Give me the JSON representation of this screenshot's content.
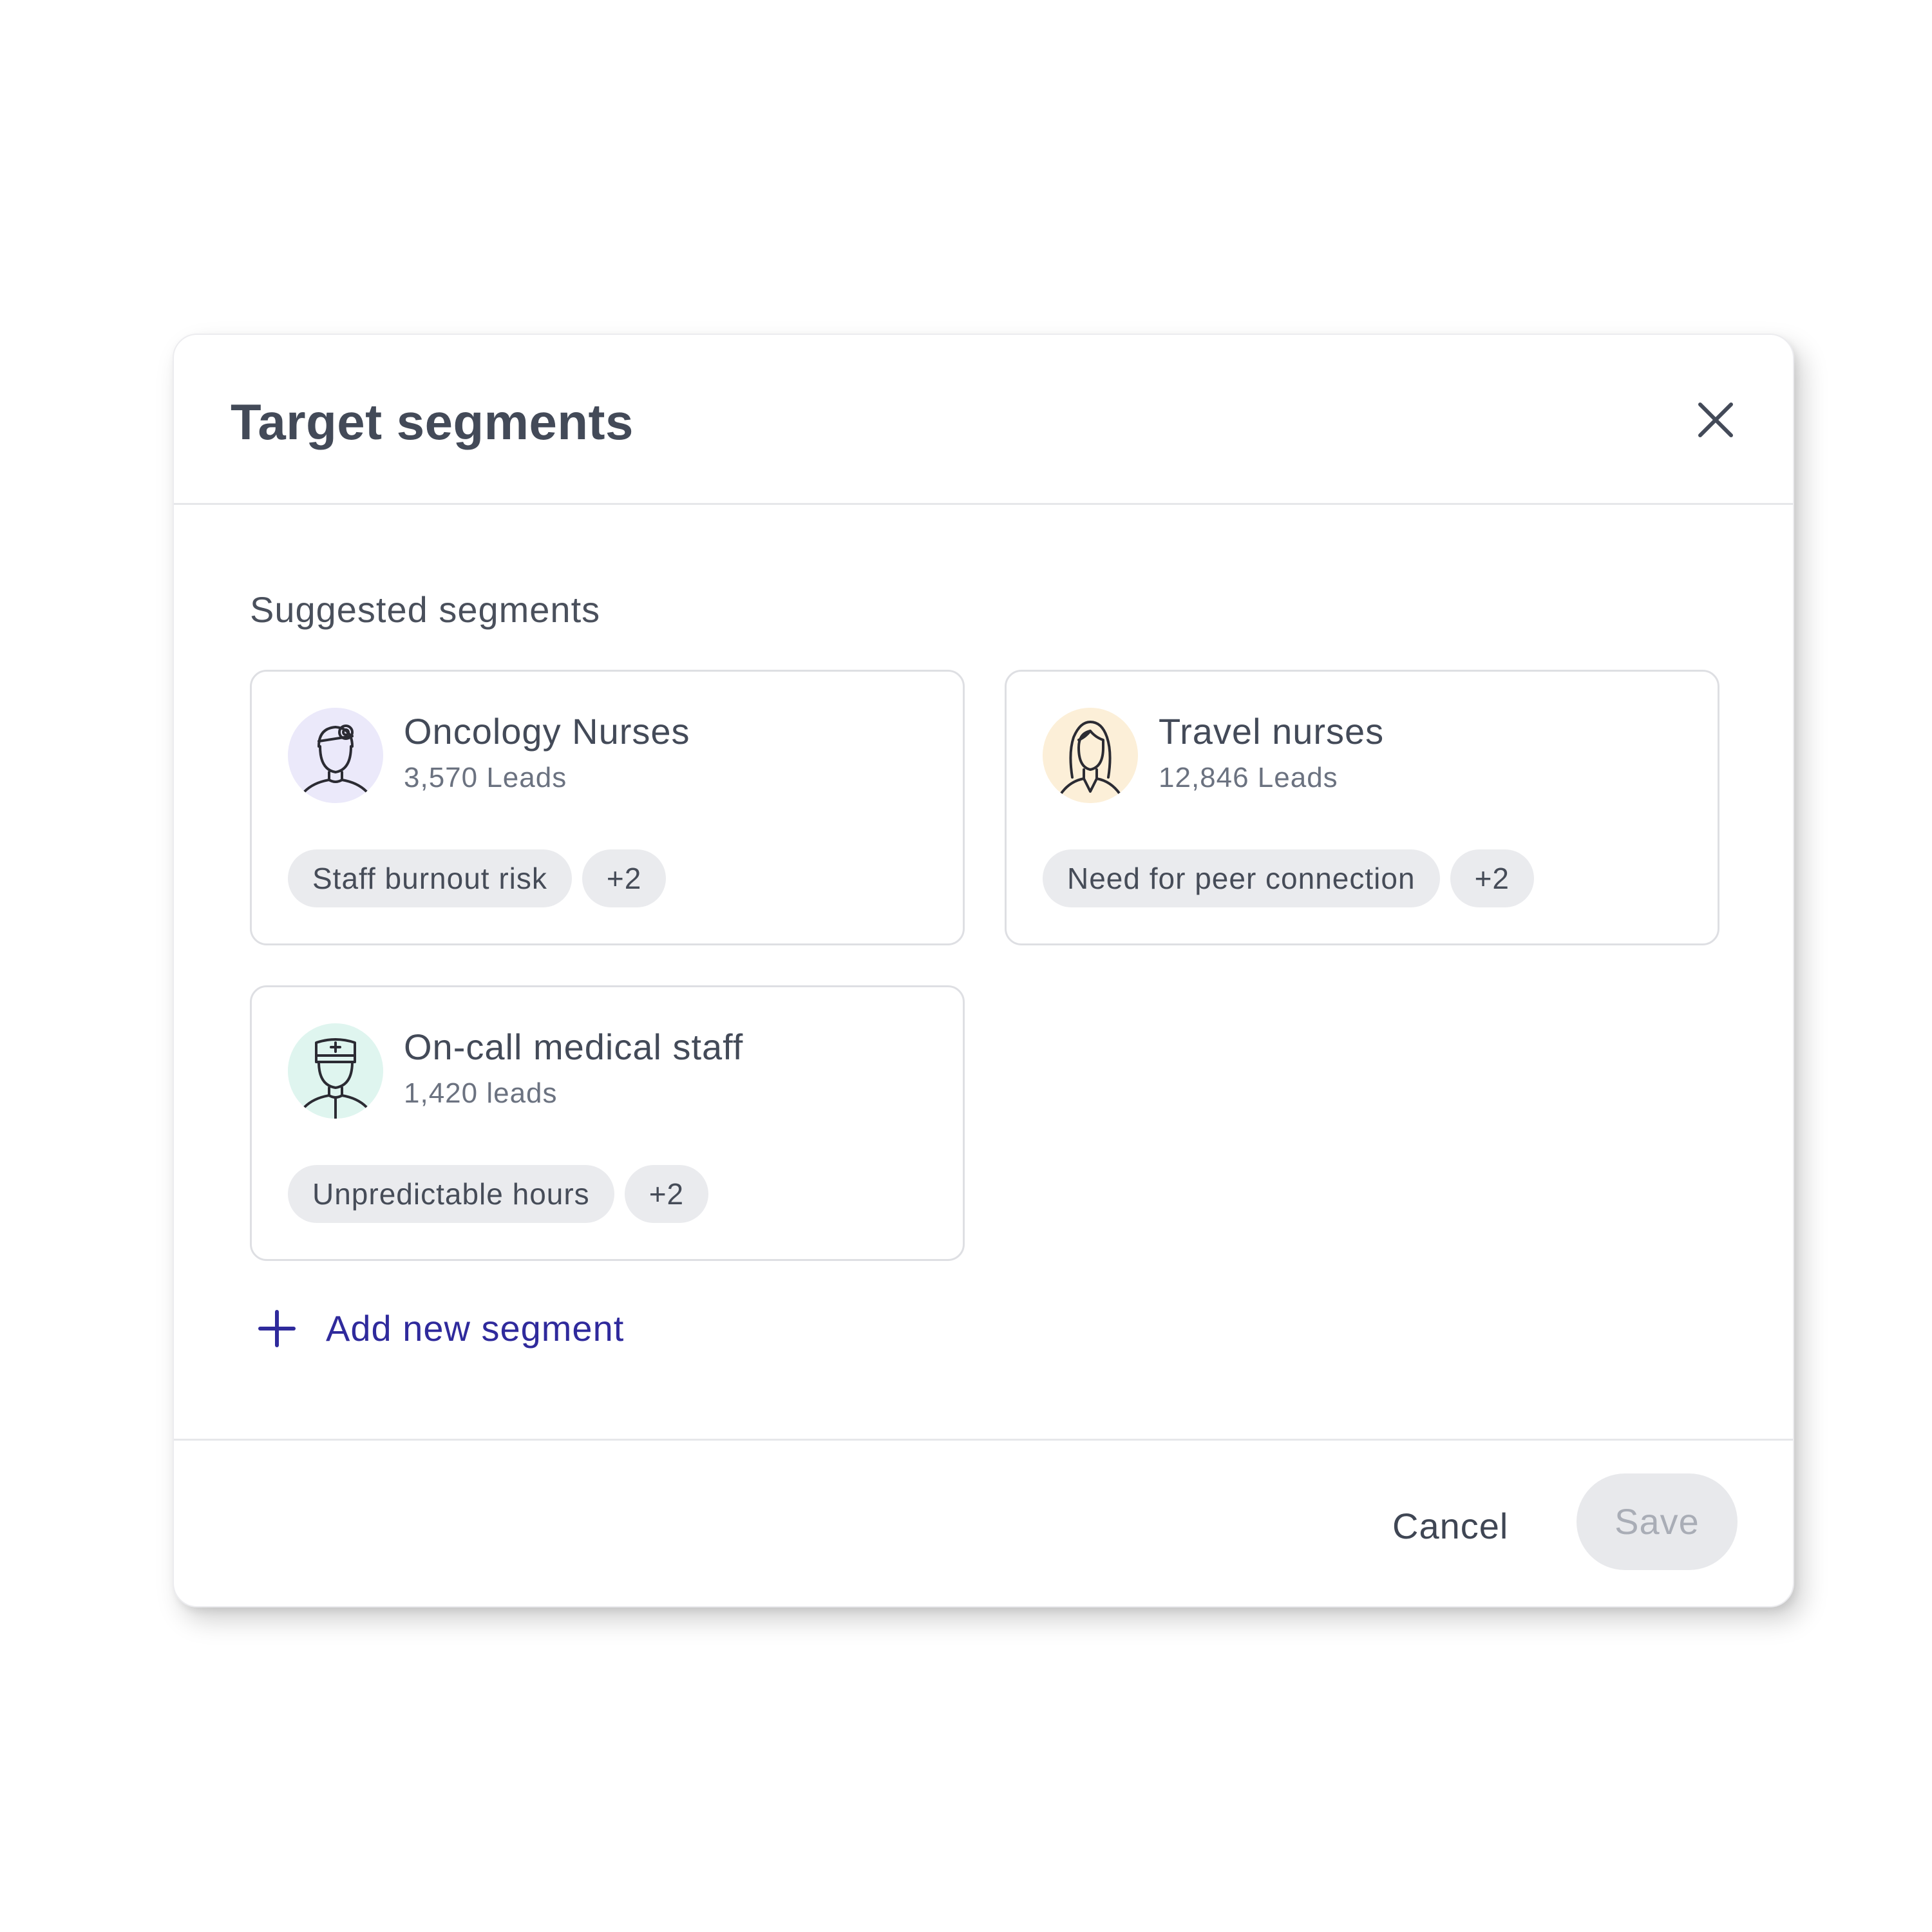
{
  "modal": {
    "title": "Target segments",
    "close_icon": "close-icon"
  },
  "section": {
    "label": "Suggested segments"
  },
  "segments": [
    {
      "name": "Oncology Nurses",
      "leads": "3,570 Leads",
      "avatar_icon": "doctor-head-mirror-icon",
      "avatar_bg": "#ebe9fa",
      "tags": [
        "Staff burnout risk"
      ],
      "more": "+2"
    },
    {
      "name": "Travel nurses",
      "leads": "12,846 Leads",
      "avatar_icon": "woman-icon",
      "avatar_bg": "#fcefd8",
      "tags": [
        "Need for peer connection"
      ],
      "more": "+2"
    },
    {
      "name": "On-call medical staff",
      "leads": "1,420 leads",
      "avatar_icon": "nurse-cap-icon",
      "avatar_bg": "#dff5ef",
      "tags": [
        "Unpredictable hours"
      ],
      "more": "+2"
    }
  ],
  "add_segment": {
    "label": "Add new segment",
    "icon": "plus-icon"
  },
  "footer": {
    "cancel_label": "Cancel",
    "save_label": "Save"
  },
  "colors": {
    "accent": "#2f2a9c",
    "text": "#434a58",
    "muted": "#6b7280",
    "chip_bg": "#eaebee",
    "save_disabled_bg": "#e8e9ec",
    "save_disabled_text": "#a9adb6"
  }
}
